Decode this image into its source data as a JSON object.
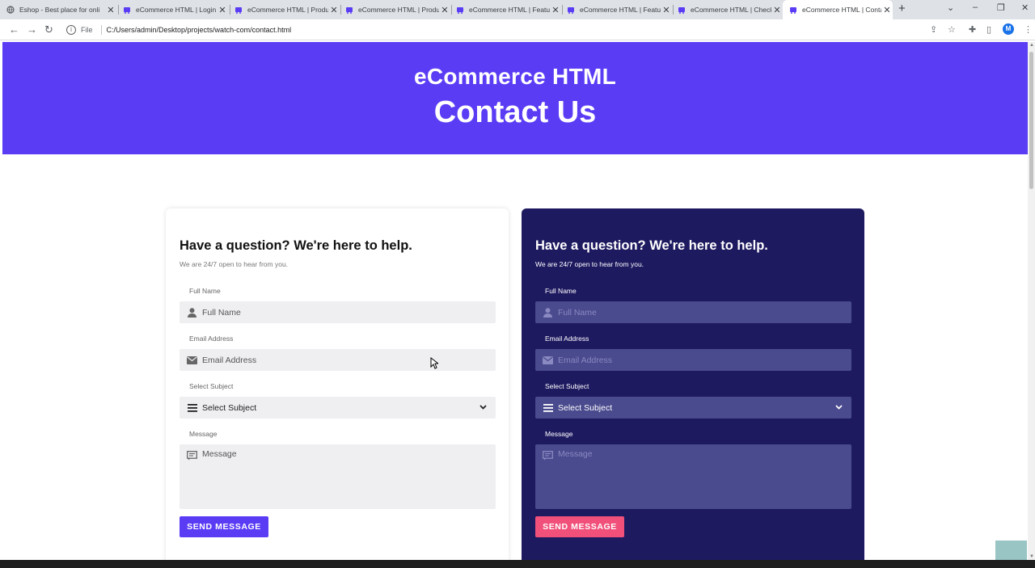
{
  "browser": {
    "tabs": [
      {
        "title": "Eshop - Best place for onli",
        "icon": "globe-icon"
      },
      {
        "title": "eCommerce HTML | Login",
        "icon": "cart-icon"
      },
      {
        "title": "eCommerce HTML | Produ",
        "icon": "cart-icon"
      },
      {
        "title": "eCommerce HTML | Produ",
        "icon": "cart-icon"
      },
      {
        "title": "eCommerce HTML | Featu",
        "icon": "cart-icon"
      },
      {
        "title": "eCommerce HTML | Featu",
        "icon": "cart-icon"
      },
      {
        "title": "eCommerce HTML | Check",
        "icon": "cart-icon"
      },
      {
        "title": "eCommerce HTML | Conta",
        "icon": "cart-icon",
        "active": true
      }
    ],
    "address": {
      "scheme_label": "File",
      "url": "C:/Users/admin/Desktop/projects/watch-com/contact.html"
    },
    "profile_initial": "M"
  },
  "hero": {
    "brand": "eCommerce HTML",
    "title": "Contact Us",
    "bg_color": "#5b3cf5"
  },
  "forms": {
    "light": {
      "heading": "Have a question? We're here to help.",
      "subheading": "We are 24/7 open to hear from you.",
      "name_label": "Full Name",
      "name_placeholder": "Full Name",
      "email_label": "Email Address",
      "email_placeholder": "Email Address",
      "subject_label": "Select Subject",
      "subject_value": "Select Subject",
      "message_label": "Message",
      "message_placeholder": "Message",
      "submit_label": "SEND MESSAGE",
      "submit_color": "#5b3cf5"
    },
    "dark": {
      "heading": "Have a question? We're here to help.",
      "subheading": "We are 24/7 open to hear from you.",
      "name_label": "Full Name",
      "name_placeholder": "Full Name",
      "email_label": "Email Address",
      "email_placeholder": "Email Address",
      "subject_label": "Select Subject",
      "subject_value": "Select Subject",
      "message_label": "Message",
      "message_placeholder": "Message",
      "submit_label": "SEND MESSAGE",
      "submit_color": "#f0507a",
      "card_color": "#1e1a60"
    }
  }
}
